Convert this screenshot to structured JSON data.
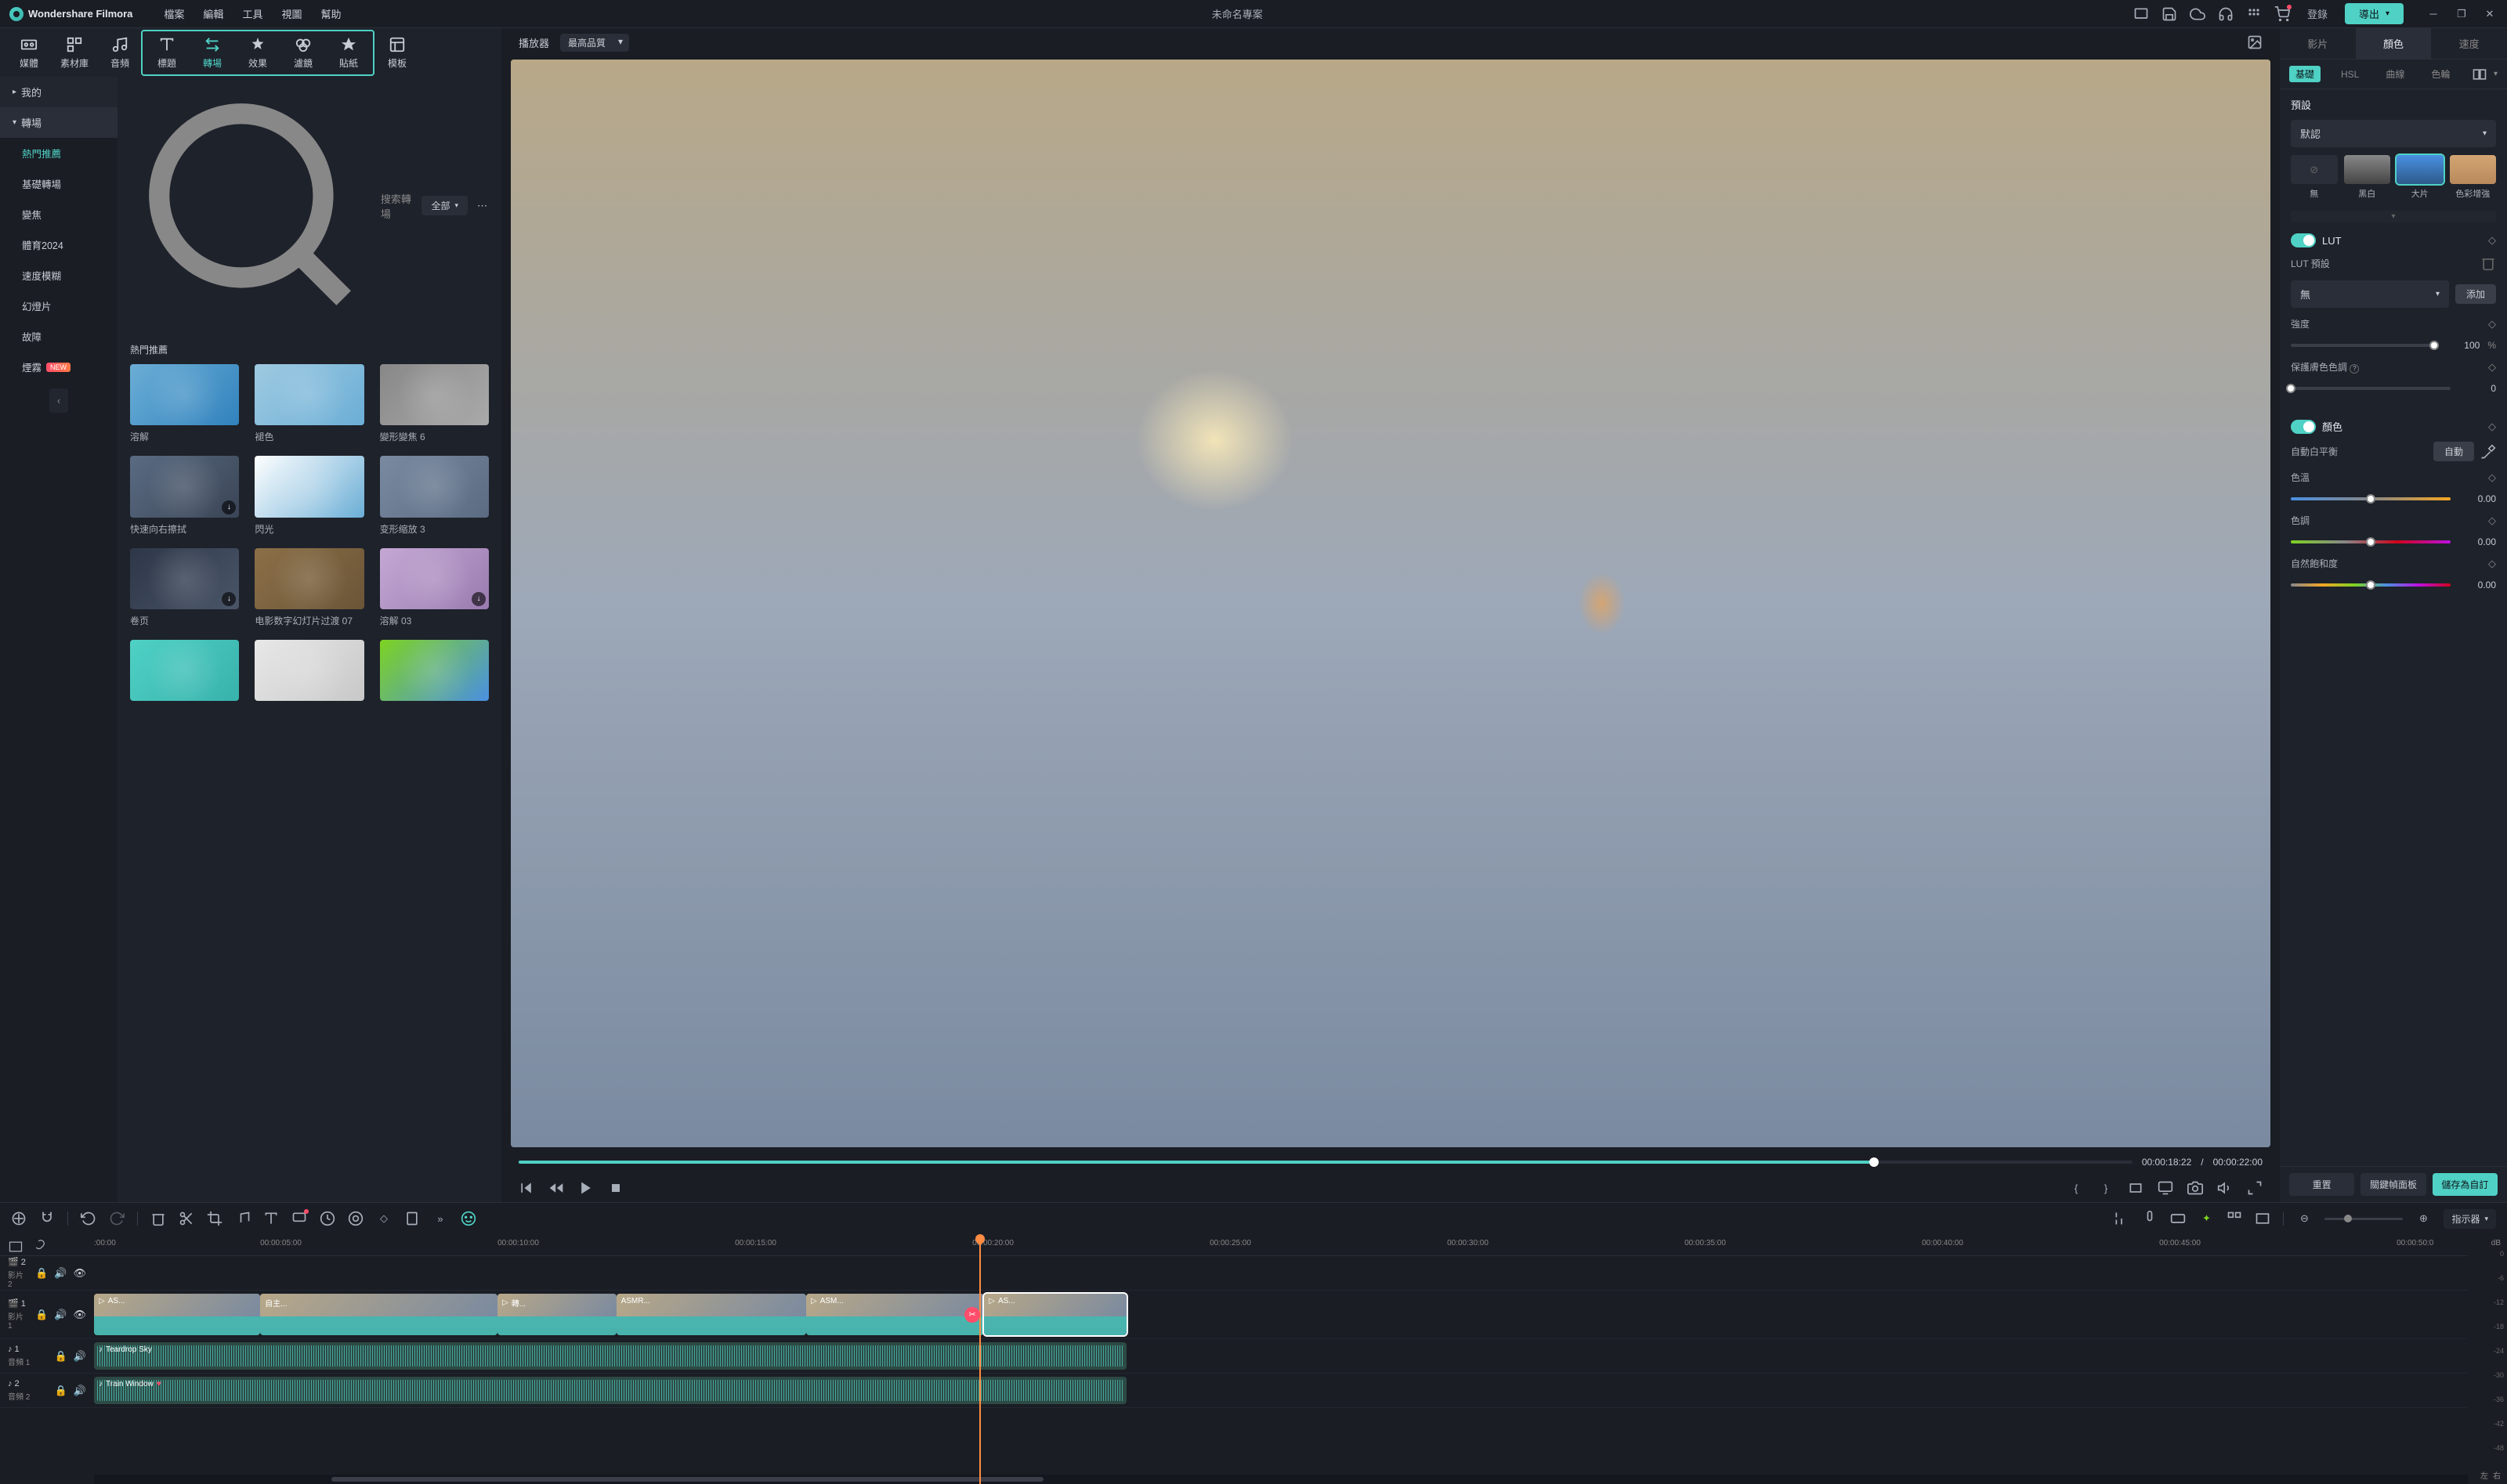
{
  "app": {
    "name": "Wondershare Filmora",
    "project": "未命名專案"
  },
  "menu": [
    "檔案",
    "編輯",
    "工具",
    "視圖",
    "幫助"
  ],
  "header": {
    "login": "登錄",
    "export": "導出"
  },
  "tabs": [
    {
      "label": "媒體"
    },
    {
      "label": "素材庫"
    },
    {
      "label": "音頻"
    },
    {
      "label": "標題"
    },
    {
      "label": "轉場"
    },
    {
      "label": "效果"
    },
    {
      "label": "濾鏡"
    },
    {
      "label": "貼紙"
    },
    {
      "label": "模板"
    }
  ],
  "sidebar": {
    "my": "我的",
    "transitions": "轉場",
    "items": [
      "熱門推薦",
      "基礎轉場",
      "變焦",
      "體育2024",
      "速度模糊",
      "幻燈片",
      "故障",
      "煙霧"
    ],
    "new_badge": "NEW"
  },
  "search": {
    "placeholder": "搜索轉場",
    "filter": "全部"
  },
  "section": "熱門推薦",
  "transitions_grid": [
    {
      "label": "溶解"
    },
    {
      "label": "褪色"
    },
    {
      "label": "變形變焦 6"
    },
    {
      "label": "快速向右擦拭",
      "badge": true
    },
    {
      "label": "閃光"
    },
    {
      "label": "变形缩放 3"
    },
    {
      "label": "卷页",
      "badge": true
    },
    {
      "label": "电影数字幻灯片过渡 07"
    },
    {
      "label": "溶解 03",
      "badge": true
    }
  ],
  "player": {
    "tab": "播放器",
    "quality": "最高品質",
    "current": "00:00:18:22",
    "sep": "/",
    "total": "00:00:22:00"
  },
  "right": {
    "tabs": [
      "影片",
      "顏色",
      "速度"
    ],
    "subtabs": [
      "基礎",
      "HSL",
      "曲線",
      "色輪"
    ],
    "preset_heading": "預設",
    "preset_default": "默認",
    "presets": [
      "無",
      "黑白",
      "大片",
      "色彩增強"
    ],
    "lut": "LUT",
    "lut_preset": "LUT 預設",
    "lut_none": "無",
    "add": "添加",
    "intensity": "強度",
    "intensity_val": "100",
    "pct": "%",
    "skin": "保護膚色色調",
    "skin_val": "0",
    "color": "顏色",
    "awb": "自動白平衡",
    "auto": "自動",
    "temp": "色溫",
    "temp_val": "0.00",
    "tint": "色調",
    "tint_val": "0.00",
    "vib": "自然飽和度",
    "vib_val": "0.00",
    "reset": "重置",
    "keyframe": "關鍵幀面板",
    "save": "儲存為自訂"
  },
  "timeline": {
    "indicator": "指示器",
    "ticks": [
      ":00:00",
      "00:00:05:00",
      "00:00:10:00",
      "00:00:15:00",
      "00:00:20:00",
      "00:00:25:00",
      "00:00:30:00",
      "00:00:35:00",
      "00:00:40:00",
      "00:00:45:00",
      "00:00:50:0"
    ],
    "track_v2": "影片 2",
    "track_v1": "影片 1",
    "track_a1": "音頻 1",
    "track_a2": "音頻 2",
    "clip_names": [
      "AS...",
      "自主...",
      "轉...",
      "ASMR...",
      "ASM...",
      "AS..."
    ],
    "audio1": "Teardrop Sky",
    "audio2": "Train Window",
    "db_marks": [
      "0",
      "-6",
      "-12",
      "-18",
      "-24",
      "-30",
      "-36",
      "-42",
      "-48",
      ""
    ],
    "db_unit": "dB",
    "lr": [
      "左",
      "右"
    ]
  }
}
